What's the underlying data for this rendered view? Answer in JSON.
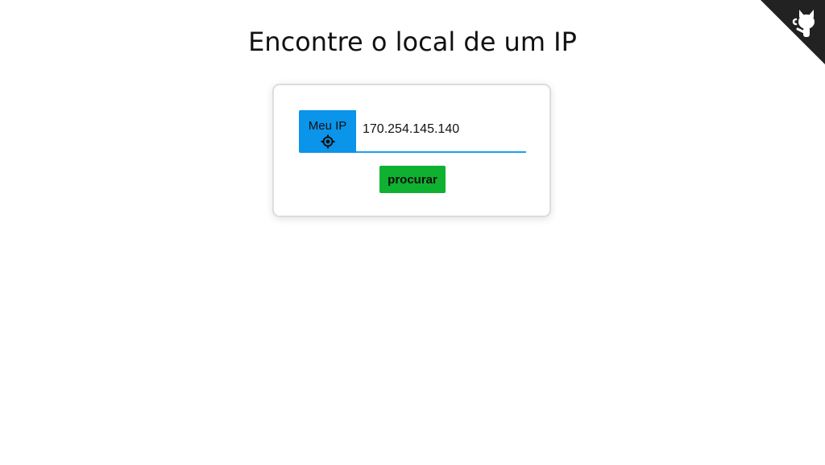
{
  "page": {
    "title": "Encontre o local de um IP"
  },
  "corner": {
    "icon": "github-octocat-icon",
    "background_color": "#222222",
    "icon_color": "#ffffff"
  },
  "form": {
    "my_ip_label": "Meu IP",
    "my_ip_icon": "target-icon",
    "ip_value": "170.254.145.140",
    "search_label": "procurar"
  },
  "colors": {
    "my_ip_button": "#0a94ea",
    "input_underline": "#1aa3e8",
    "search_button": "#0fb130"
  }
}
